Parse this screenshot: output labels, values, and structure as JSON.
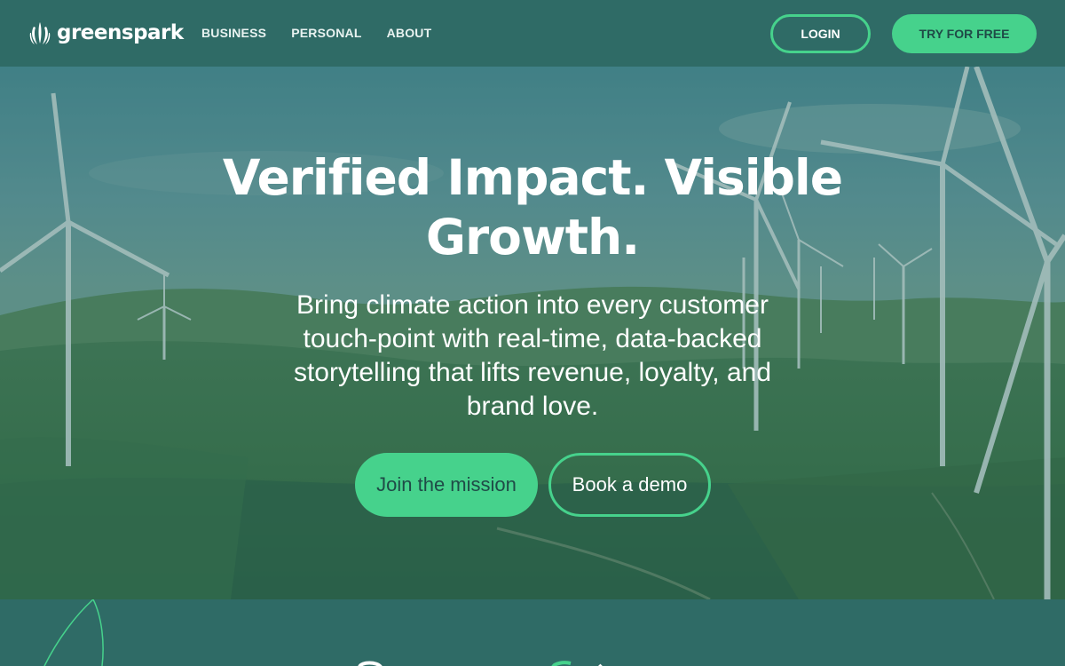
{
  "brand": {
    "name": "greenspark"
  },
  "nav": {
    "links": [
      {
        "label": "BUSINESS"
      },
      {
        "label": "PERSONAL"
      },
      {
        "label": "ABOUT"
      }
    ],
    "login_label": "LOGIN",
    "try_label": "TRY FOR FREE"
  },
  "hero": {
    "title": "Verified Impact. Visible Growth.",
    "subtitle": "Bring climate action into every customer touch-point with real-time, data-backed storytelling that lifts revenue, loyalty, and brand love.",
    "primary_cta": "Join the mission",
    "secondary_cta": "Book a demo",
    "background": "wind-turbines-landscape"
  },
  "colors": {
    "header_bg": "#2f6b66",
    "accent_green": "#46d28c",
    "dark_text": "#1f4b47"
  },
  "icons": [
    "greenspark-logo-icon",
    "leaf-outline-icon"
  ]
}
